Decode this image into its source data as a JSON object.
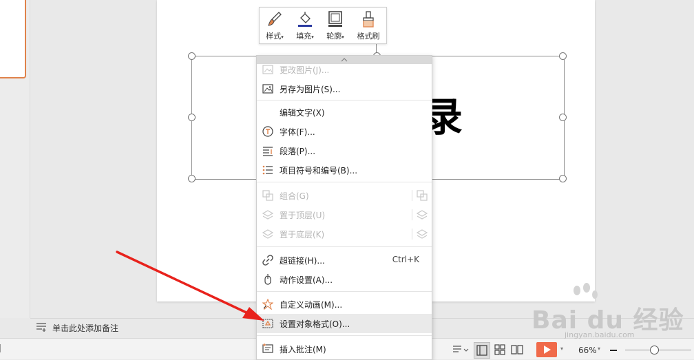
{
  "mini_toolbar": {
    "items": [
      {
        "label": "样式",
        "has_dropdown": true,
        "icon": "brush-icon"
      },
      {
        "label": "填充",
        "has_dropdown": true,
        "icon": "fill-bucket-icon"
      },
      {
        "label": "轮廓",
        "has_dropdown": true,
        "icon": "outline-icon"
      },
      {
        "label": "格式刷",
        "has_dropdown": false,
        "icon": "format-painter-icon"
      }
    ]
  },
  "slide": {
    "visible_text_fragment": "录"
  },
  "context_menu": {
    "items": [
      {
        "label": "更改图片(J)...",
        "icon": "change-picture-icon",
        "disabled": true
      },
      {
        "label": "另存为图片(S)...",
        "icon": "save-picture-icon",
        "disabled": false
      },
      {
        "label": "编辑文字(X)",
        "icon": "",
        "disabled": false
      },
      {
        "label": "字体(F)...",
        "icon": "font-icon",
        "disabled": false
      },
      {
        "label": "段落(P)...",
        "icon": "paragraph-icon",
        "disabled": false
      },
      {
        "label": "项目符号和编号(B)...",
        "icon": "bullets-icon",
        "disabled": false
      },
      {
        "label": "组合(G)",
        "icon": "group-icon",
        "disabled": true
      },
      {
        "label": "置于顶层(U)",
        "icon": "bring-to-front-icon",
        "disabled": true
      },
      {
        "label": "置于底层(K)",
        "icon": "send-to-back-icon",
        "disabled": true
      },
      {
        "label": "超链接(H)...",
        "icon": "hyperlink-icon",
        "disabled": false,
        "shortcut": "Ctrl+K"
      },
      {
        "label": "动作设置(A)...",
        "icon": "mouse-icon",
        "disabled": false
      },
      {
        "label": "自定义动画(M)...",
        "icon": "custom-animation-icon",
        "disabled": false
      },
      {
        "label": "设置对象格式(O)...",
        "icon": "format-object-icon",
        "disabled": false,
        "highlighted": true
      },
      {
        "label": "插入批注(M)",
        "icon": "insert-comment-icon",
        "disabled": false
      }
    ]
  },
  "notes": {
    "placeholder": "单击此处添加备注"
  },
  "status_bar": {
    "zoom": "66%"
  },
  "watermark": {
    "brand": "Bai du 经验",
    "url": "jingyan.baidu.com"
  },
  "colors": {
    "accent_orange": "#e0824a",
    "play_button": "#f06a4a",
    "arrow_red": "#e8221c"
  }
}
